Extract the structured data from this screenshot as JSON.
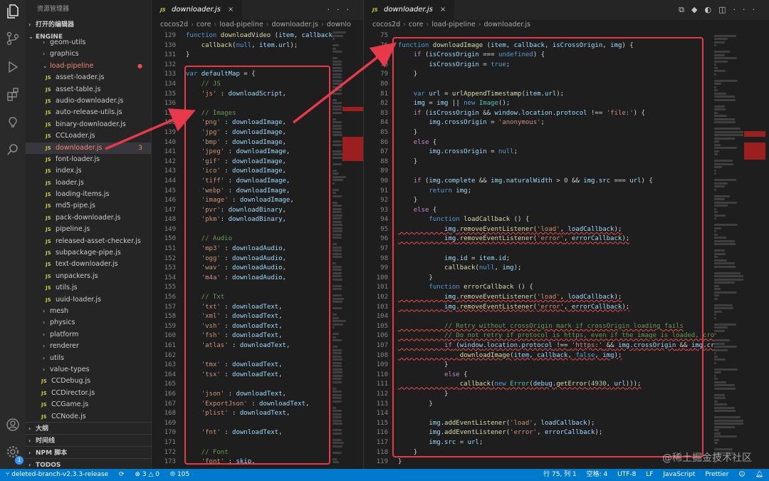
{
  "activity_bar": {
    "icons": [
      "files-icon",
      "source-control-icon",
      "run-debug-icon",
      "extensions-icon",
      "remote-icon",
      "search-icon"
    ],
    "bottom_icons": [
      "account-icon",
      "manage-gear-icon"
    ],
    "manage_badge": "1"
  },
  "sidebar": {
    "title": "资源管理器",
    "open_editors_label": "打开的编辑器",
    "root_label": "ENGINE",
    "items": [
      {
        "label": "geom-utils",
        "kind": "folder"
      },
      {
        "label": "graphics",
        "kind": "folder"
      },
      {
        "label": "load-pipeline",
        "kind": "folder-open",
        "modified": true
      },
      {
        "label": "asset-loader.js",
        "kind": "js"
      },
      {
        "label": "asset-table.js",
        "kind": "js"
      },
      {
        "label": "audio-downloader.js",
        "kind": "js"
      },
      {
        "label": "auto-release-utils.js",
        "kind": "js"
      },
      {
        "label": "binary-downloader.js",
        "kind": "js"
      },
      {
        "label": "CCLoader.js",
        "kind": "js"
      },
      {
        "label": "downloader.js",
        "kind": "js",
        "selected": true,
        "errors": "3"
      },
      {
        "label": "font-loader.js",
        "kind": "js"
      },
      {
        "label": "index.js",
        "kind": "js"
      },
      {
        "label": "loader.js",
        "kind": "js"
      },
      {
        "label": "loading-items.js",
        "kind": "js"
      },
      {
        "label": "md5-pipe.js",
        "kind": "js"
      },
      {
        "label": "pack-downloader.js",
        "kind": "js"
      },
      {
        "label": "pipeline.js",
        "kind": "js"
      },
      {
        "label": "released-asset-checker.js",
        "kind": "js"
      },
      {
        "label": "subpackage-pipe.js",
        "kind": "js"
      },
      {
        "label": "text-downloader.js",
        "kind": "js"
      },
      {
        "label": "unpackers.js",
        "kind": "js"
      },
      {
        "label": "utils.js",
        "kind": "js"
      },
      {
        "label": "uuid-loader.js",
        "kind": "js"
      },
      {
        "label": "mesh",
        "kind": "folder"
      },
      {
        "label": "physics",
        "kind": "folder"
      },
      {
        "label": "platform",
        "kind": "folder"
      },
      {
        "label": "renderer",
        "kind": "folder"
      },
      {
        "label": "utils",
        "kind": "folder"
      },
      {
        "label": "value-types",
        "kind": "folder"
      },
      {
        "label": "CCDebug.js",
        "kind": "js-root"
      },
      {
        "label": "CCDirector.js",
        "kind": "js-root"
      },
      {
        "label": "CCGame.js",
        "kind": "js-root"
      },
      {
        "label": "CCNode.js",
        "kind": "js-root"
      }
    ],
    "sections": [
      "大纲",
      "时间线",
      "NPM 脚本",
      "TODOS"
    ]
  },
  "editor_left": {
    "tab": "downloader.js",
    "breadcrumb": [
      "cocos2d",
      "core",
      "load-pipeline",
      "downloader.js",
      "downlo"
    ],
    "lines": [
      {
        "n": "129",
        "t": "function downloadVideo (item, callback"
      },
      {
        "n": "130",
        "t": "    callback(null, item.url);"
      },
      {
        "n": "131",
        "t": "}"
      },
      {
        "n": "132",
        "t": ""
      },
      {
        "n": "133",
        "t": "var defaultMap = {"
      },
      {
        "n": "134",
        "t": "    // JS"
      },
      {
        "n": "135",
        "t": "    'js' : downloadScript,"
      },
      {
        "n": "136",
        "t": ""
      },
      {
        "n": "137",
        "t": "    // Images"
      },
      {
        "n": "138",
        "t": "    'png' : downloadImage,"
      },
      {
        "n": "139",
        "t": "    'jpg' : downloadImage,"
      },
      {
        "n": "140",
        "t": "    'bmp' : downloadImage,"
      },
      {
        "n": "141",
        "t": "    'jpeg' : downloadImage,"
      },
      {
        "n": "142",
        "t": "    'gif' : downloadImage,"
      },
      {
        "n": "143",
        "t": "    'ico' : downloadImage,"
      },
      {
        "n": "144",
        "t": "    'tiff' : downloadImage,"
      },
      {
        "n": "145",
        "t": "    'webp' : downloadImage,"
      },
      {
        "n": "146",
        "t": "    'image' : downloadImage,"
      },
      {
        "n": "147",
        "t": "    'pvr': downloadBinary,"
      },
      {
        "n": "148",
        "t": "    'pkm': downloadBinary,"
      },
      {
        "n": "149",
        "t": ""
      },
      {
        "n": "150",
        "t": "    // Audio"
      },
      {
        "n": "151",
        "t": "    'mp3' : downloadAudio,"
      },
      {
        "n": "152",
        "t": "    'ogg' : downloadAudio,"
      },
      {
        "n": "153",
        "t": "    'wav' : downloadAudio,"
      },
      {
        "n": "154",
        "t": "    'm4a' : downloadAudio,"
      },
      {
        "n": "155",
        "t": ""
      },
      {
        "n": "156",
        "t": "    // Txt"
      },
      {
        "n": "157",
        "t": "    'txt' : downloadText,"
      },
      {
        "n": "158",
        "t": "    'xml' : downloadText,"
      },
      {
        "n": "159",
        "t": "    'vsh' : downloadText,"
      },
      {
        "n": "160",
        "t": "    'fsh' : downloadText,"
      },
      {
        "n": "161",
        "t": "    'atlas' : downloadText,"
      },
      {
        "n": "162",
        "t": ""
      },
      {
        "n": "163",
        "t": "    'tmx' : downloadText,"
      },
      {
        "n": "164",
        "t": "    'tsx' : downloadText,"
      },
      {
        "n": "165",
        "t": ""
      },
      {
        "n": "166",
        "t": "    'json' : downloadText,"
      },
      {
        "n": "167",
        "t": "    'ExportJson' : downloadText,"
      },
      {
        "n": "168",
        "t": "    'plist' : downloadText,"
      },
      {
        "n": "169",
        "t": ""
      },
      {
        "n": "170",
        "t": "    'fnt' : downloadText,"
      },
      {
        "n": "171",
        "t": ""
      },
      {
        "n": "172",
        "t": "    // Font"
      },
      {
        "n": "173",
        "t": "    'font' : skip,"
      }
    ]
  },
  "editor_right": {
    "tab": "downloader.js",
    "breadcrumb": [
      "cocos2d",
      "core",
      "load-pipeline",
      "downloader.js"
    ],
    "lines": [
      {
        "n": "75",
        "t": ""
      },
      {
        "n": "76",
        "t": "function downloadImage (item, callback, isCrossOrigin, img) {"
      },
      {
        "n": "77",
        "t": "    if (isCrossOrigin === undefined) {"
      },
      {
        "n": "78",
        "t": "        isCrossOrigin = true;"
      },
      {
        "n": "79",
        "t": "    }"
      },
      {
        "n": "80",
        "t": ""
      },
      {
        "n": "81",
        "t": "    var url = urlAppendTimestamp(item.url);"
      },
      {
        "n": "82",
        "t": "    img = img || new Image();"
      },
      {
        "n": "83",
        "t": "    if (isCrossOrigin && window.location.protocol !== 'file:') {"
      },
      {
        "n": "84",
        "t": "        img.crossOrigin = 'anonymous';"
      },
      {
        "n": "85",
        "t": "    }"
      },
      {
        "n": "86",
        "t": "    else {"
      },
      {
        "n": "87",
        "t": "        img.crossOrigin = null;"
      },
      {
        "n": "88",
        "t": "    }"
      },
      {
        "n": "89",
        "t": ""
      },
      {
        "n": "90",
        "t": "    if (img.complete && img.naturalWidth > 0 && img.src === url) {"
      },
      {
        "n": "91",
        "t": "        return img;"
      },
      {
        "n": "92",
        "t": "    }"
      },
      {
        "n": "93",
        "t": "    else {"
      },
      {
        "n": "94",
        "t": "        function loadCallback () {"
      },
      {
        "n": "95",
        "t": "            img.removeEventListener('load', loadCallback);"
      },
      {
        "n": "96",
        "t": "            img.removeEventListener('error', errorCallback);"
      },
      {
        "n": "97",
        "t": ""
      },
      {
        "n": "98",
        "t": "            img.id = item.id;"
      },
      {
        "n": "99",
        "t": "            callback(null, img);"
      },
      {
        "n": "100",
        "t": "        }"
      },
      {
        "n": "101",
        "t": "        function errorCallback () {"
      },
      {
        "n": "102",
        "t": "            img.removeEventListener('load', loadCallback);"
      },
      {
        "n": "103",
        "t": "            img.removeEventListener('error', errorCallback);"
      },
      {
        "n": "104",
        "t": ""
      },
      {
        "n": "105",
        "t": "            // Retry without crossOrigin mark if crossOrigin loading fails"
      },
      {
        "n": "106",
        "t": "            // Do not retry if protocol is https, even if the image is loaded, cro"
      },
      {
        "n": "107",
        "t": "            if (window.location.protocol !== 'https:' && img.crossOrigin && img.cr"
      },
      {
        "n": "108",
        "t": "                downloadImage(item, callback, false, img);"
      },
      {
        "n": "109",
        "t": "            }"
      },
      {
        "n": "110",
        "t": "            else {"
      },
      {
        "n": "111",
        "t": "                callback(new Error(debug.getError(4930, url)));"
      },
      {
        "n": "112",
        "t": "            }"
      },
      {
        "n": "113",
        "t": "        }"
      },
      {
        "n": "114",
        "t": ""
      },
      {
        "n": "115",
        "t": "        img.addEventListener('load', loadCallback);"
      },
      {
        "n": "116",
        "t": "        img.addEventListener('error', errorCallback);"
      },
      {
        "n": "117",
        "t": "        img.src = url;"
      },
      {
        "n": "118",
        "t": "    }"
      },
      {
        "n": "119",
        "t": "}"
      }
    ]
  },
  "statusbar": {
    "branch": "deleted-branch-v2.3.3-release",
    "errors": "3",
    "warnings": "0",
    "ports": "105",
    "position": "行 75, 列 1",
    "spaces": "空格: 4",
    "encoding": "UTF-8",
    "eol": "LF",
    "language": "JavaScript",
    "formatter": "Prettier"
  },
  "watermark": "@稀土掘金技术社区",
  "colors": {
    "accent": "#007acc",
    "highlight_box": "#e8394a",
    "editor_bg": "#1e1e1e",
    "sidebar_bg": "#252526"
  }
}
